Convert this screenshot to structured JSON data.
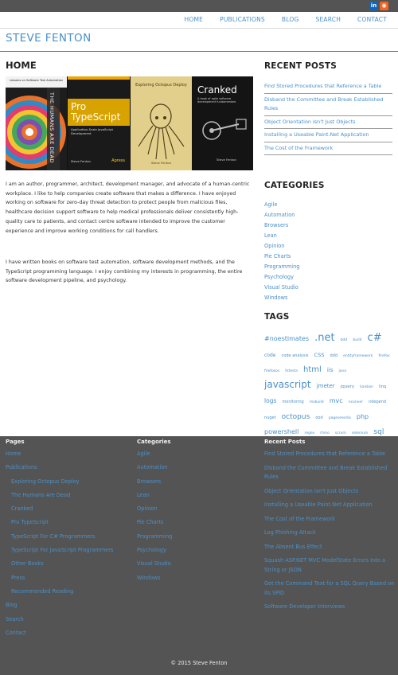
{
  "social": [
    {
      "label": "in",
      "color": "#0a66c2",
      "icon": "linkedin-icon"
    },
    {
      "label": "◉",
      "color": "#f26522",
      "icon": "rss-icon"
    }
  ],
  "nav": {
    "items": [
      {
        "label": "HOME"
      },
      {
        "label": "PUBLICATIONS"
      },
      {
        "label": "BLOG"
      },
      {
        "label": "SEARCH"
      },
      {
        "label": "CONTACT"
      }
    ]
  },
  "site": {
    "title": "STEVE FENTON"
  },
  "page": {
    "title": "HOME"
  },
  "books": [
    {
      "title": "THE HUMANS ARE DEAD",
      "subtitle": "Lessons on Software Test Automation"
    },
    {
      "title": "Pro TypeScript",
      "subtitle": "Application-Scale JavaScript Development",
      "author": "Steve Fenton",
      "publisher": "Apress"
    },
    {
      "title": "Exploring Octopus Deploy",
      "author": "Steve Fenton"
    },
    {
      "title": "Cranked",
      "subtitle": "A book of agile software development fundamentals",
      "author": "Steve Fenton"
    }
  ],
  "intro": {
    "p1": "I am an author, programmer, architect, development manager, and advocate of a human-centric workplace. I like to help companies create software that makes a difference. I have enjoyed working on software for zero-day threat detection to protect people from malicious files, healthcare decision support software to help medical professionals deliver consistently high-quality care to patients, and contact centre software intended to improve the customer experience and improve working conditions for call handlers.",
    "p2": "I have written books on software test automation, software development methods, and the TypeScript programming language. I enjoy combining my interests in programming, the entire software development pipeline, and psychology."
  },
  "sidebar": {
    "recent_heading": "RECENT POSTS",
    "recent": [
      "Find Stored Procedures that Reference a Table",
      "Disband the Committee and Break Established Rules",
      "Object Orientation Isn't Just Objects",
      "Installing a Useable Paint.Net Application",
      "The Cost of the Framework"
    ],
    "categories_heading": "CATEGORIES",
    "categories": [
      "Agile",
      "Automation",
      "Browsers",
      "Lean",
      "Opinion",
      "Pie Charts",
      "Programming",
      "Psychology",
      "Visual Studio",
      "Windows"
    ],
    "tags_heading": "TAGS",
    "tags": [
      {
        "t": "#noestimates",
        "s": 8
      },
      {
        "t": ".net",
        "s": 13
      },
      {
        "t": "bdd",
        "s": 4.5
      },
      {
        "t": "build",
        "s": 4.5
      },
      {
        "t": "c#",
        "s": 13
      },
      {
        "t": "code",
        "s": 6
      },
      {
        "t": "code analysis",
        "s": 5
      },
      {
        "t": "CSS",
        "s": 6.5
      },
      {
        "t": "ddd",
        "s": 5
      },
      {
        "t": "entityframework",
        "s": 4.5
      },
      {
        "t": "firefox",
        "s": 4.5
      },
      {
        "t": "firefoxos",
        "s": 4.5
      },
      {
        "t": "fxtesta",
        "s": 4.5
      },
      {
        "t": "html",
        "s": 10
      },
      {
        "t": "iis",
        "s": 7
      },
      {
        "t": "java",
        "s": 4.5
      },
      {
        "t": "javascript",
        "s": 12
      },
      {
        "t": "jmeter",
        "s": 7
      },
      {
        "t": "jquery",
        "s": 5.5
      },
      {
        "t": "kanban",
        "s": 4.5
      },
      {
        "t": "linq",
        "s": 5
      },
      {
        "t": "logs",
        "s": 7.5
      },
      {
        "t": "monitoring",
        "s": 5
      },
      {
        "t": "msbuild",
        "s": 4.5
      },
      {
        "t": "mvc",
        "s": 8
      },
      {
        "t": "nconver",
        "s": 4.5
      },
      {
        "t": "ndepend",
        "s": 5
      },
      {
        "t": "nuget",
        "s": 5
      },
      {
        "t": "octopus",
        "s": 9
      },
      {
        "t": "ood",
        "s": 5
      },
      {
        "t": "pageomedia",
        "s": 4.5
      },
      {
        "t": "php",
        "s": 8
      },
      {
        "t": "powershell",
        "s": 8
      },
      {
        "t": "regex",
        "s": 4.5
      },
      {
        "t": "rhino",
        "s": 4.5
      },
      {
        "t": "scrum",
        "s": 4.5
      },
      {
        "t": "selenium",
        "s": 4.5
      },
      {
        "t": "sql",
        "s": 9
      },
      {
        "t": "tdd",
        "s": 6.5
      },
      {
        "t": "typescript",
        "s": 12
      },
      {
        "t": "typespec",
        "s": 4.5
      },
      {
        "t": "vscode",
        "s": 5.5
      },
      {
        "t": "wcf",
        "s": 5
      },
      {
        "t": "webdriver",
        "s": 4.5
      },
      {
        "t": "wix",
        "s": 4.5
      },
      {
        "t": "xml",
        "s": 4.5
      }
    ]
  },
  "footer": {
    "pages_heading": "Pages",
    "pages": [
      {
        "label": "Home",
        "sub": false
      },
      {
        "label": "Publications",
        "sub": false
      },
      {
        "label": "Exploring Octopus Deploy",
        "sub": true
      },
      {
        "label": "The Humans Are Dead",
        "sub": true
      },
      {
        "label": "Cranked",
        "sub": true
      },
      {
        "label": "Pro TypeScript",
        "sub": true
      },
      {
        "label": "TypeScript For C# Programmers",
        "sub": true
      },
      {
        "label": "TypeScript For JavaScript Programmers",
        "sub": true
      },
      {
        "label": "Other Books",
        "sub": true
      },
      {
        "label": "Press",
        "sub": true
      },
      {
        "label": "Recommended Reading",
        "sub": true
      },
      {
        "label": "Blog",
        "sub": false
      },
      {
        "label": "Search",
        "sub": false
      },
      {
        "label": "Contact",
        "sub": false
      }
    ],
    "categories_heading": "Categories",
    "categories": [
      "Agile",
      "Automation",
      "Browsers",
      "Lean",
      "Opinion",
      "Pie Charts",
      "Programming",
      "Psychology",
      "Visual Studio",
      "Windows"
    ],
    "recent_heading": "Recent Posts",
    "recent": [
      "Find Stored Procedures that Reference a Table",
      "Disband the Committee and Break Established Rules",
      "Object Orientation Isn't Just Objects",
      "Installing a Useable Paint.Net Application",
      "The Cost of the Framework",
      "Log Phishing Attack",
      "The Absent Bus Effect",
      "Squash ASP.NET MVC ModelState Errors Into a String or JSON",
      "Get the Command Text for a SQL Query Based on its SPID",
      "Software Developer Interviews"
    ],
    "copyright": "© 2015 Steve Fenton"
  },
  "colors": {
    "accent": "#4a90c9",
    "footer_bg": "#545454",
    "topbar_bg": "#545454"
  }
}
